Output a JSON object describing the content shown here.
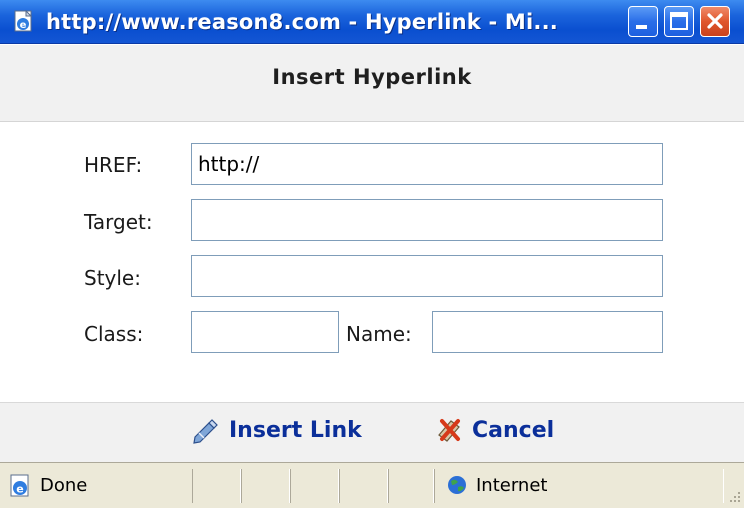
{
  "window": {
    "title": "http://www.reason8.com - Hyperlink - Mi...",
    "icon": "ie-page-icon"
  },
  "dialog": {
    "title": "Insert Hyperlink"
  },
  "form": {
    "href": {
      "label": "HREF:",
      "value": "http://"
    },
    "target": {
      "label": "Target:",
      "value": ""
    },
    "style": {
      "label": "Style:",
      "value": ""
    },
    "class": {
      "label": "Class:",
      "value": ""
    },
    "name": {
      "label": "Name:",
      "value": ""
    }
  },
  "actions": {
    "insert_label": "Insert Link",
    "cancel_label": "Cancel"
  },
  "status": {
    "left_text": "Done",
    "zone_text": "Internet"
  },
  "colors": {
    "titlebar": "#0a4fd0",
    "link": "#0b2f9a",
    "header_bg": "#f1f1f1",
    "field_border": "#7f9db9",
    "statusbar_bg": "#ece9d8"
  }
}
